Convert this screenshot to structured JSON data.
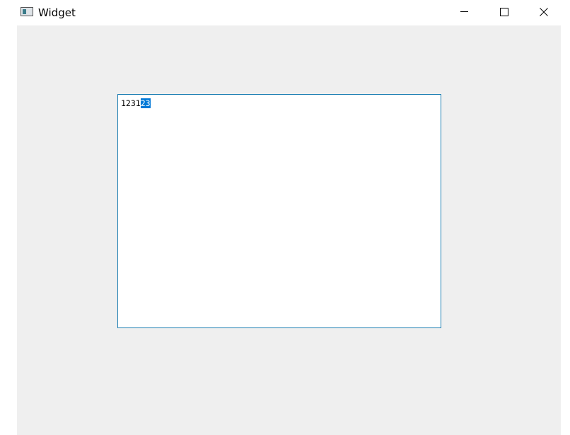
{
  "window": {
    "title": "Widget",
    "icon": "app-window-icon",
    "controls": {
      "minimize_icon": "minimize-icon",
      "maximize_icon": "maximize-icon",
      "close_icon": "close-icon"
    }
  },
  "editor": {
    "text_unselected": "1231",
    "text_selected": "23"
  },
  "colors": {
    "client_background": "#efefef",
    "editor_border": "#1e7fb3",
    "selection": "#0078d7"
  }
}
